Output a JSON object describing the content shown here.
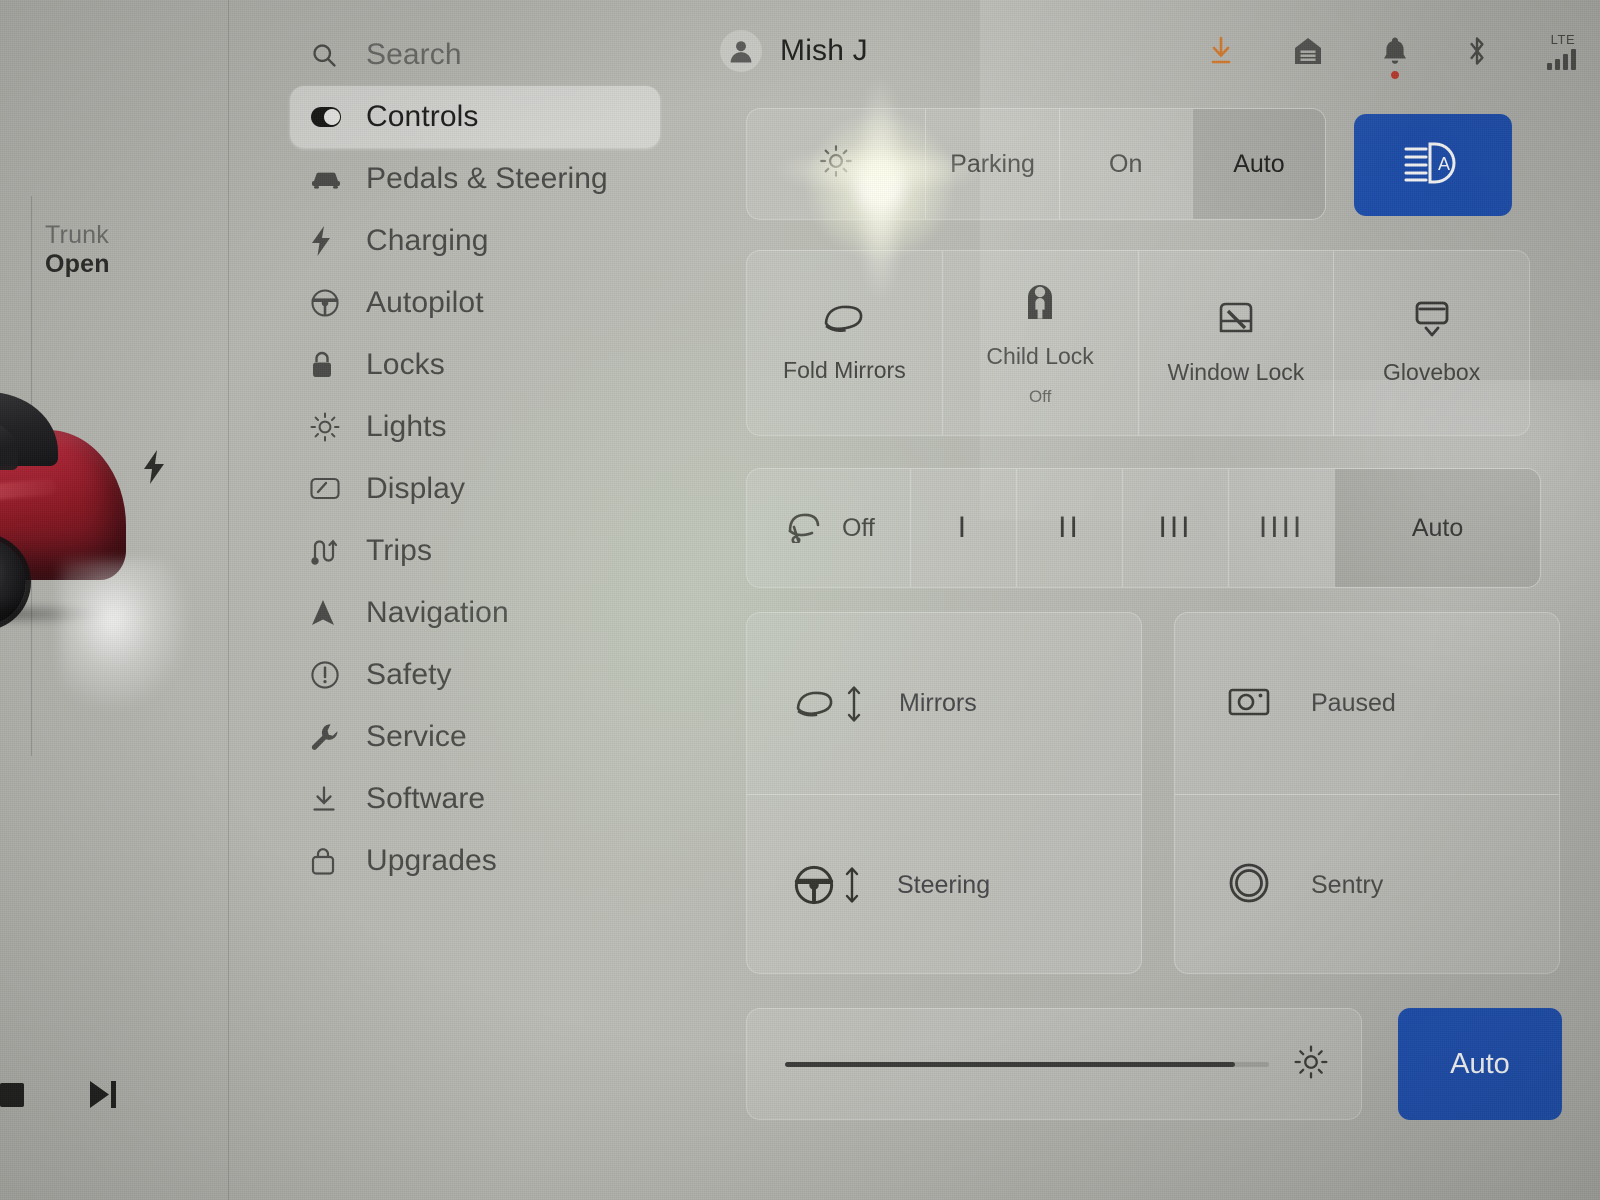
{
  "colors": {
    "accent_blue": "#1d4fb0",
    "selected_gray": "#a8a9a4",
    "screen_bg": "#b6b6b1",
    "text_primary": "#222321",
    "text_secondary": "#4a4b48",
    "notification_dot": "#c0392b",
    "download_icon": "#d8741f",
    "car_body": "#a8202f"
  },
  "car_status": {
    "label": "Trunk",
    "value": "Open",
    "charge_icon": "charge-bolt-icon"
  },
  "media_controls": [
    {
      "name": "stop-button",
      "icon": "stop-icon"
    },
    {
      "name": "next-track-button",
      "icon": "next-track-icon"
    }
  ],
  "sidebar": {
    "items": [
      {
        "label": "Search",
        "icon": "search-icon",
        "name": "sidebar-item-search",
        "active": false
      },
      {
        "label": "Controls",
        "icon": "toggle-switch-icon",
        "name": "sidebar-item-controls",
        "active": true
      },
      {
        "label": "Pedals & Steering",
        "icon": "car-front-icon",
        "name": "sidebar-item-pedals",
        "active": false
      },
      {
        "label": "Charging",
        "icon": "lightning-bolt-icon",
        "name": "sidebar-item-charging",
        "active": false
      },
      {
        "label": "Autopilot",
        "icon": "steering-wheel-icon",
        "name": "sidebar-item-autopilot",
        "active": false
      },
      {
        "label": "Locks",
        "icon": "padlock-icon",
        "name": "sidebar-item-locks",
        "active": false
      },
      {
        "label": "Lights",
        "icon": "sun-lights-icon",
        "name": "sidebar-item-lights",
        "active": false
      },
      {
        "label": "Display",
        "icon": "display-screen-icon",
        "name": "sidebar-item-display",
        "active": false
      },
      {
        "label": "Trips",
        "icon": "trips-route-icon",
        "name": "sidebar-item-trips",
        "active": false
      },
      {
        "label": "Navigation",
        "icon": "navigation-arrow-icon",
        "name": "sidebar-item-navigation",
        "active": false
      },
      {
        "label": "Safety",
        "icon": "alert-circle-icon",
        "name": "sidebar-item-safety",
        "active": false
      },
      {
        "label": "Service",
        "icon": "wrench-icon",
        "name": "sidebar-item-service",
        "active": false
      },
      {
        "label": "Software",
        "icon": "download-tray-icon",
        "name": "sidebar-item-software",
        "active": false
      },
      {
        "label": "Upgrades",
        "icon": "shopping-bag-icon",
        "name": "sidebar-item-upgrades",
        "active": false
      }
    ]
  },
  "statusbar": {
    "profile_name": "Mish J",
    "profile_icon": "person-avatar-icon",
    "icons": [
      {
        "name": "software-download-icon",
        "label": "download"
      },
      {
        "name": "garage-home-icon",
        "label": "garage"
      },
      {
        "name": "notification-bell-icon",
        "label": "notifications",
        "badge": true
      },
      {
        "name": "bluetooth-icon",
        "label": "bluetooth"
      }
    ],
    "connectivity": {
      "network_label": "LTE",
      "bars": 4,
      "icon": "signal-bars-icon"
    }
  },
  "lights_row": {
    "icon": "sun-lights-icon",
    "options": [
      {
        "label": "Parking",
        "selected": false
      },
      {
        "label": "On",
        "selected": false
      },
      {
        "label": "Auto",
        "selected": true
      }
    ],
    "auto_high_beam": {
      "icon": "auto-high-beam-icon",
      "active": true
    }
  },
  "quick_toggles": [
    {
      "label": "Fold Mirrors",
      "sub": "",
      "icon": "side-mirror-icon"
    },
    {
      "label": "Child Lock",
      "sub": "Off",
      "icon": "child-lock-icon"
    },
    {
      "label": "Window Lock",
      "sub": "",
      "icon": "window-lock-icon"
    },
    {
      "label": "Glovebox",
      "sub": "",
      "icon": "glovebox-icon"
    }
  ],
  "wipers": {
    "off_label": "Off",
    "icon": "windshield-wiper-icon",
    "speeds": [
      {
        "label": "I",
        "ticks": 1,
        "selected": false
      },
      {
        "label": "II",
        "ticks": 2,
        "selected": false
      },
      {
        "label": "III",
        "ticks": 3,
        "selected": false
      },
      {
        "label": "IIII",
        "ticks": 4,
        "selected": false
      }
    ],
    "auto_label": "Auto",
    "auto_selected": true
  },
  "adjust_panel": [
    {
      "label": "Mirrors",
      "icon": "side-mirror-adjust-icon"
    },
    {
      "label": "Steering",
      "icon": "steering-wheel-adjust-icon"
    }
  ],
  "camera_panel": [
    {
      "label": "Paused",
      "icon": "dashcam-icon"
    },
    {
      "label": "Sentry",
      "icon": "sentry-mode-icon"
    }
  ],
  "brightness": {
    "icon": "brightness-sun-icon",
    "value_percent": 93,
    "auto_label": "Auto",
    "auto_active": true
  }
}
